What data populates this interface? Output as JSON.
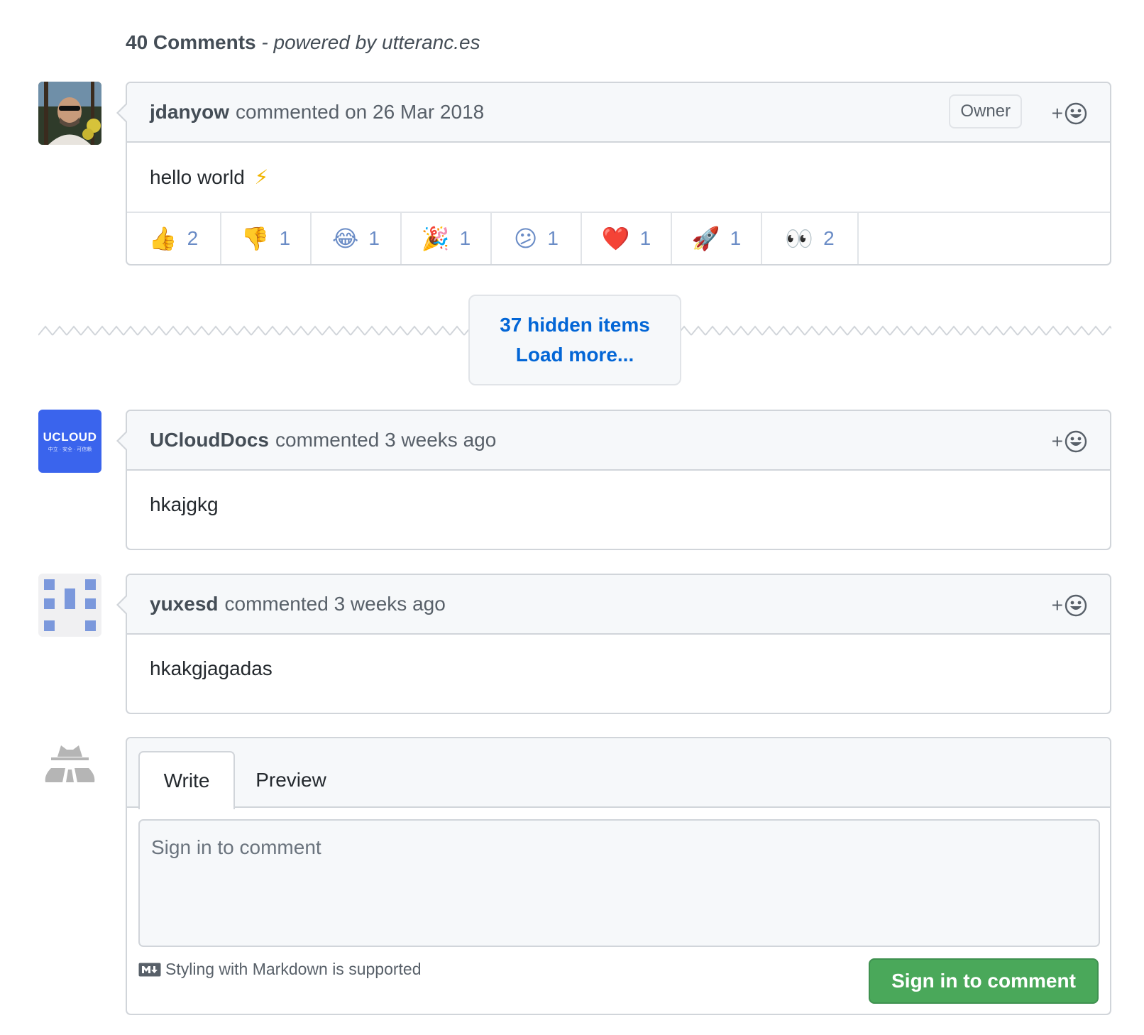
{
  "header": {
    "count": "40 Comments",
    "powered": "- powered by utteranc.es"
  },
  "comments": [
    {
      "author": "jdanyow",
      "meta": "commented on 26 Mar 2018",
      "badge": "Owner",
      "body": "hello world",
      "body_emoji": "⚡",
      "reactions": [
        {
          "emoji": "👍",
          "count": "2"
        },
        {
          "emoji": "👎",
          "count": "1"
        },
        {
          "emoji": "😂",
          "count": "1"
        },
        {
          "emoji": "🎉",
          "count": "1"
        },
        {
          "emoji": "😕",
          "count": "1"
        },
        {
          "emoji": "❤️",
          "count": "1"
        },
        {
          "emoji": "🚀",
          "count": "1"
        },
        {
          "emoji": "👀",
          "count": "2"
        }
      ]
    },
    {
      "author": "UCloudDocs",
      "meta": "commented 3 weeks ago",
      "body": "hkajgkg",
      "avatar_text": "UCLOUD",
      "avatar_sub": "中立 · 安全 · 可信赖"
    },
    {
      "author": "yuxesd",
      "meta": "commented 3 weeks ago",
      "body": "hkakgjagadas"
    }
  ],
  "hidden": {
    "count_text": "37 hidden items",
    "load_text": "Load more..."
  },
  "editor": {
    "tab_write": "Write",
    "tab_preview": "Preview",
    "placeholder": "Sign in to comment",
    "markdown_note": "Styling with Markdown is supported",
    "submit_label": "Sign in to comment"
  },
  "reaction_plus": "+",
  "colors": {
    "link": "#0366d6",
    "button": "#4aa85a",
    "ucloud": "#3a64ed"
  }
}
